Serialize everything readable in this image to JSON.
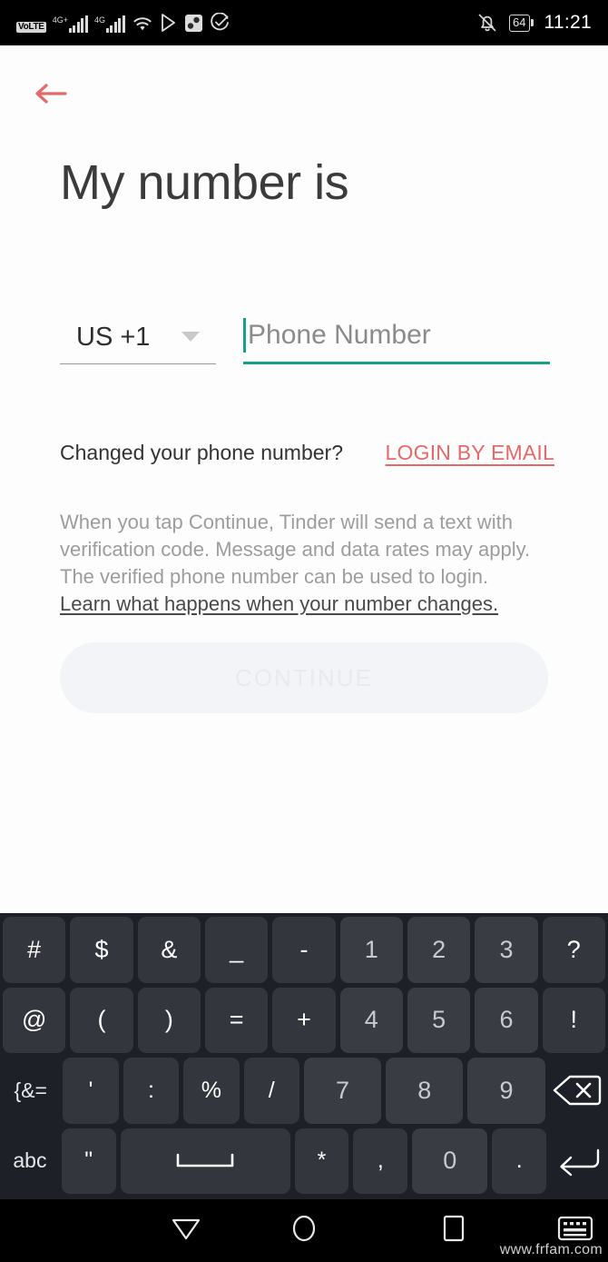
{
  "status_bar": {
    "volte_label": "VoLTE",
    "network_1": "4G+",
    "network_2": "4G",
    "icons": [
      "volte-icon",
      "signal-4g-plus-icon",
      "signal-4g-icon",
      "wifi-icon",
      "play-store-icon",
      "app-icon",
      "check-circle-icon",
      "mute-bell-icon"
    ],
    "battery_level": "64",
    "time": "11:21"
  },
  "app": {
    "back_icon": "back-arrow-icon",
    "title": "My number is",
    "country_code": "US +1",
    "phone_placeholder": "Phone Number",
    "changed_question": "Changed your phone number?",
    "login_by_email": "LOGIN BY EMAIL",
    "legal_text": "When you tap Continue, Tinder will send a text with verification code. Message and data rates may apply. The verified phone number can be used to login. ",
    "learn_link": "Learn what happens when your number changes.",
    "continue_label": "CONTINUE",
    "accent_red": "#e26a6a",
    "accent_teal": "#16a085"
  },
  "keyboard": {
    "rows": [
      [
        {
          "label": "#",
          "kind": "sym"
        },
        {
          "label": "$",
          "kind": "sym"
        },
        {
          "label": "&",
          "kind": "sym"
        },
        {
          "label": "_",
          "kind": "sym"
        },
        {
          "label": "-",
          "kind": "sym"
        },
        {
          "label": "1",
          "kind": "num"
        },
        {
          "label": "2",
          "kind": "num"
        },
        {
          "label": "3",
          "kind": "num"
        },
        {
          "label": "?",
          "kind": "sym"
        }
      ],
      [
        {
          "label": "@",
          "kind": "sym"
        },
        {
          "label": "(",
          "kind": "sym"
        },
        {
          "label": ")",
          "kind": "sym"
        },
        {
          "label": "=",
          "kind": "sym"
        },
        {
          "label": "+",
          "kind": "sym"
        },
        {
          "label": "4",
          "kind": "num"
        },
        {
          "label": "5",
          "kind": "num"
        },
        {
          "label": "6",
          "kind": "num"
        },
        {
          "label": "!",
          "kind": "sym"
        }
      ],
      [
        {
          "label": "{&=",
          "kind": "flat"
        },
        {
          "label": "'",
          "kind": "sym"
        },
        {
          "label": ":",
          "kind": "sym"
        },
        {
          "label": "%",
          "kind": "sym"
        },
        {
          "label": "/",
          "kind": "sym"
        },
        {
          "label": "7",
          "kind": "num"
        },
        {
          "label": "8",
          "kind": "num"
        },
        {
          "label": "9",
          "kind": "num"
        },
        {
          "label": "",
          "kind": "backspace"
        }
      ],
      [
        {
          "label": "abc",
          "kind": "flat"
        },
        {
          "label": "\"",
          "kind": "sym"
        },
        {
          "label": "",
          "kind": "space"
        },
        {
          "label": "*",
          "kind": "sym"
        },
        {
          "label": ",",
          "kind": "sym"
        },
        {
          "label": "0",
          "kind": "num"
        },
        {
          "label": ".",
          "kind": "sym"
        },
        {
          "label": "",
          "kind": "enter"
        }
      ]
    ]
  },
  "navbar": {
    "back_icon": "nav-back-triangle-icon",
    "home_icon": "nav-home-circle-icon",
    "recents_icon": "nav-recents-square-icon",
    "keyboard_icon": "nav-keyboard-icon",
    "watermark": "www.frfam.com"
  }
}
